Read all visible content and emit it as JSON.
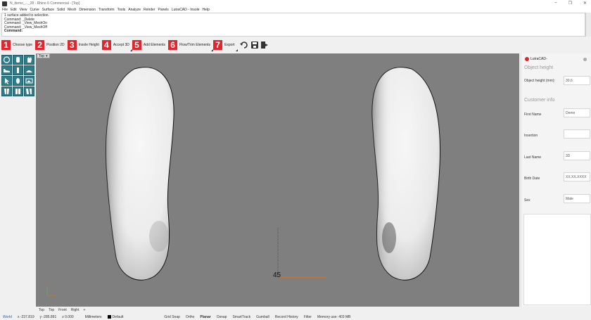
{
  "window": {
    "title": "N_demo_..._28 - Rhino 6 Commercial - [Top]",
    "minimize": "–",
    "maximize": "❐",
    "close": "✕"
  },
  "menu": [
    "File",
    "Edit",
    "View",
    "Curve",
    "Surface",
    "Solid",
    "Mesh",
    "Dimension",
    "Transform",
    "Tools",
    "Analyze",
    "Render",
    "Panels",
    "LutraCAD - Insole",
    "Help"
  ],
  "command_history": [
    "1 surface added to selection.",
    "Command: _Delete",
    "Command: _View_MeshOn",
    "Command: _View_MeshOff"
  ],
  "command_prompt": "Command:",
  "steps": [
    {
      "num": "1",
      "label": "Choose type"
    },
    {
      "num": "2",
      "label": "Position 2D"
    },
    {
      "num": "3",
      "label": "Insole Height"
    },
    {
      "num": "4",
      "label": "Accept 3D"
    },
    {
      "num": "5",
      "label": "Add Elements"
    },
    {
      "num": "6",
      "label": "Flow/Trim Elements"
    },
    {
      "num": "7",
      "label": "Export"
    }
  ],
  "toolbar_icons": [
    "undo-icon",
    "save-icon",
    "exit-icon"
  ],
  "viewport": {
    "tab": "Top",
    "dimension_label": "45"
  },
  "view_tabs": [
    "Top",
    "Top",
    "Front",
    "Right",
    "+"
  ],
  "right_panel": {
    "brand": "LutraCAD-",
    "object_height_title": "Object height",
    "object_height_label": "Object height (mm):",
    "object_height_value": "30,6",
    "customer_info_title": "Customer info",
    "fields": [
      {
        "label": "First Name",
        "value": "Demo"
      },
      {
        "label": "Insertion",
        "value": ""
      },
      {
        "label": "Last Name",
        "value": "3D"
      },
      {
        "label": "Birth Date",
        "value": "XX.XX.XXXX"
      },
      {
        "label": "Sex",
        "value": "Male"
      }
    ]
  },
  "status": {
    "world": "World",
    "x": "x -237.819",
    "y": "y -285.891",
    "z": "z 0.000",
    "units": "Millimeters",
    "layer": "Default",
    "grid_snap": "Grid Snap",
    "ortho": "Ortho",
    "planar": "Planar",
    "osnap": "Osnap",
    "smarttrack": "SmartTrack",
    "gumball": "Gumball",
    "record_history": "Record History",
    "filter": "Filter",
    "memory": "Memory use: 403 MB"
  },
  "colors": {
    "step_red": "#e3262c",
    "tool_teal": "#2f7c8a",
    "viewport_gray": "#7f7f7f",
    "x_axis": "#c8722a"
  }
}
